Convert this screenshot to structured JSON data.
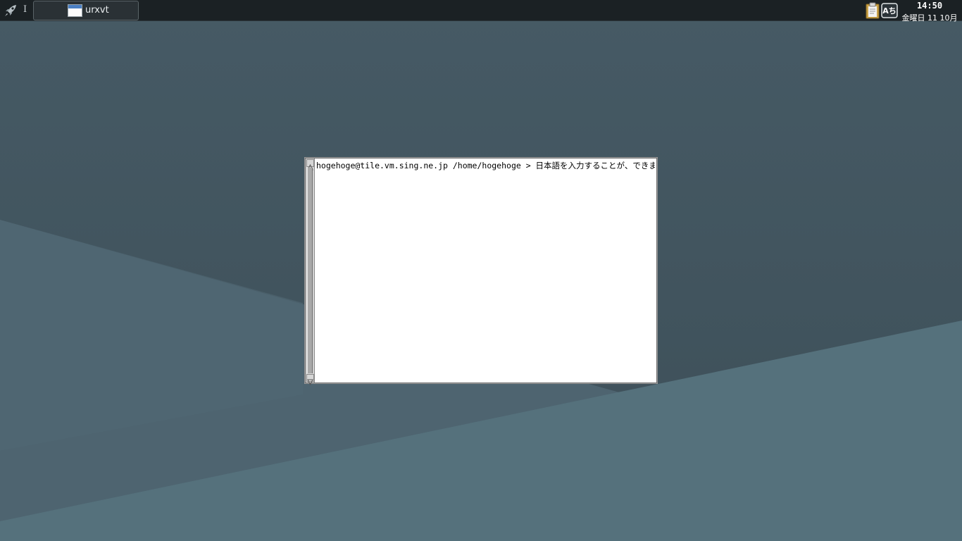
{
  "panel": {
    "launcher_icon": "rocket-icon",
    "separator_glyph": "I",
    "taskbar": {
      "items": [
        {
          "icon": "window-icon",
          "label": "urxvt"
        }
      ]
    },
    "tray": {
      "clipboard_icon": "clipboard-icon",
      "ime_icon": "input-method-icon",
      "ime_glyph": "Aち",
      "clock_time": "14:50",
      "clock_date": "金曜日 11 10月"
    }
  },
  "terminal": {
    "title": "urxvt",
    "lines": [
      "hogehoge@tile.vm.sing.ne.jp /home/hogehoge > 日本語を入力することが、できます。"
    ]
  },
  "colors": {
    "panel_bg": "#1b2124",
    "desktop_dark": "#435661",
    "desktop_light": "#56737e",
    "terminal_bg": "#ffffff"
  }
}
